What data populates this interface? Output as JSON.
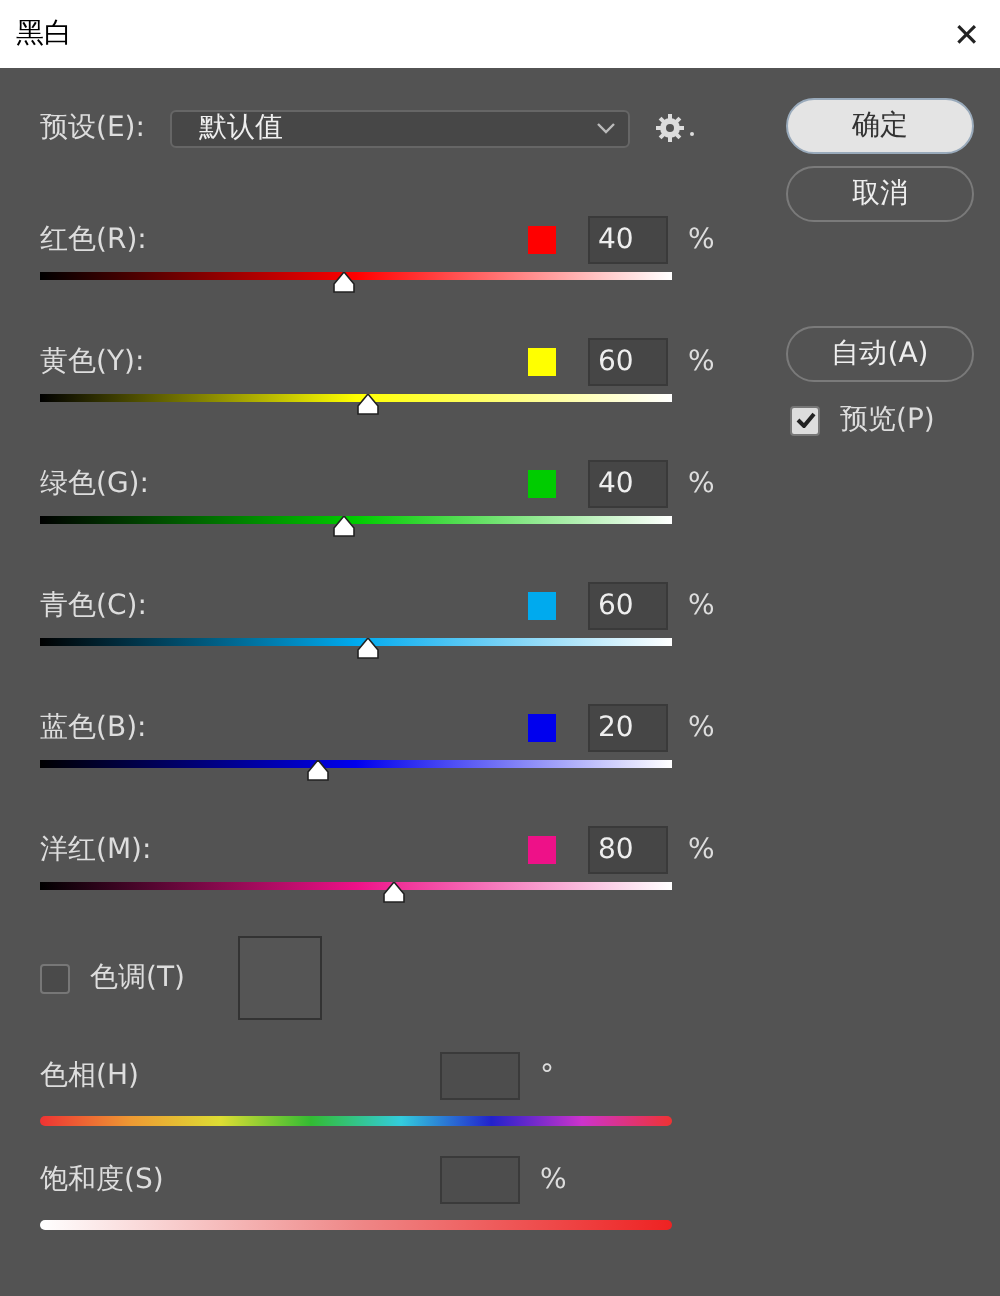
{
  "window": {
    "title": "黑白",
    "close": "✕"
  },
  "preset": {
    "label": "预设(E):",
    "value": "默认值"
  },
  "channels": [
    {
      "name": "红色(R):",
      "color": "#ff0000",
      "value": "40",
      "unit": "%",
      "level": 0.48
    },
    {
      "name": "黄色(Y):",
      "color": "#ffff00",
      "value": "60",
      "unit": "%",
      "level": 0.52
    },
    {
      "name": "绿色(G):",
      "color": "#00cc00",
      "value": "40",
      "unit": "%",
      "level": 0.48
    },
    {
      "name": "青色(C):",
      "color": "#00aaee",
      "value": "60",
      "unit": "%",
      "level": 0.52
    },
    {
      "name": "蓝色(B):",
      "color": "#0000ee",
      "value": "20",
      "unit": "%",
      "level": 0.44
    },
    {
      "name": "洋红(M):",
      "color": "#ee1188",
      "value": "80",
      "unit": "%",
      "level": 0.56
    }
  ],
  "tint": {
    "label": "色调(T)",
    "checked": false
  },
  "tint_sliders": [
    {
      "kind": "hue",
      "name": "色相(H)",
      "unit": "°"
    },
    {
      "kind": "saturation",
      "name": "饱和度(S)",
      "unit": "%"
    }
  ],
  "buttons": [
    {
      "label": "确定",
      "default": true
    },
    {
      "label": "取消",
      "default": false
    },
    {
      "label": "自动(A)",
      "default": false
    }
  ],
  "preview": {
    "label": "预览(P)",
    "checked": true
  }
}
